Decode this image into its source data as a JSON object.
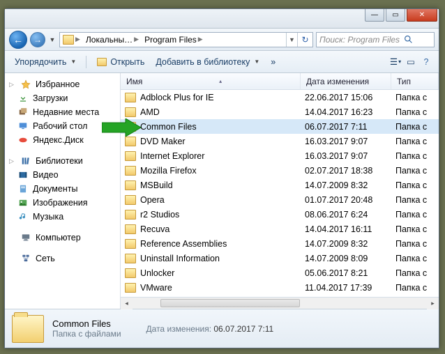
{
  "window": {
    "min_glyph": "—",
    "max_glyph": "▭",
    "close_glyph": "✕"
  },
  "nav": {
    "back_glyph": "←",
    "fwd_glyph": "→",
    "menu_glyph": "▼",
    "breadcrumbs": [
      {
        "label": "Локальны…"
      },
      {
        "label": "Program Files"
      }
    ],
    "addr_dd": "▼",
    "refresh_glyph": "↻"
  },
  "search": {
    "placeholder": "Поиск: Program Files"
  },
  "toolbar": {
    "organize": "Упорядочить",
    "open": "Открыть",
    "add_to_library": "Добавить в библиотеку",
    "share": "»",
    "view_glyph": "☰",
    "preview_glyph": "▭",
    "help_glyph": "?"
  },
  "sidebar": {
    "favorites": {
      "label": "Избранное",
      "items": [
        {
          "icon": "dl",
          "label": "Загрузки"
        },
        {
          "icon": "folder",
          "label": "Недавние места"
        },
        {
          "icon": "desk",
          "label": "Рабочий стол"
        },
        {
          "icon": "yd",
          "label": "Яндекс.Диск"
        }
      ]
    },
    "libraries": {
      "label": "Библиотеки",
      "items": [
        {
          "icon": "vid",
          "label": "Видео"
        },
        {
          "icon": "doc",
          "label": "Документы"
        },
        {
          "icon": "img",
          "label": "Изображения"
        },
        {
          "icon": "music",
          "label": "Музыка"
        }
      ]
    },
    "computer": {
      "label": "Компьютер"
    },
    "network": {
      "label": "Сеть"
    }
  },
  "columns": {
    "name": "Имя",
    "date": "Дата изменения",
    "type": "Тип",
    "sort_glyph": "▴"
  },
  "files": [
    {
      "name": "Adblock Plus for IE",
      "date": "22.06.2017 15:06",
      "type": "Папка с",
      "sel": false
    },
    {
      "name": "AMD",
      "date": "14.04.2017 16:23",
      "type": "Папка с",
      "sel": false
    },
    {
      "name": "Common Files",
      "date": "06.07.2017 7:11",
      "type": "Папка с",
      "sel": true
    },
    {
      "name": "DVD Maker",
      "date": "16.03.2017 9:07",
      "type": "Папка с",
      "sel": false
    },
    {
      "name": "Internet Explorer",
      "date": "16.03.2017 9:07",
      "type": "Папка с",
      "sel": false
    },
    {
      "name": "Mozilla Firefox",
      "date": "02.07.2017 18:38",
      "type": "Папка с",
      "sel": false
    },
    {
      "name": "MSBuild",
      "date": "14.07.2009 8:32",
      "type": "Папка с",
      "sel": false
    },
    {
      "name": "Opera",
      "date": "01.07.2017 20:48",
      "type": "Папка с",
      "sel": false
    },
    {
      "name": "r2 Studios",
      "date": "08.06.2017 6:24",
      "type": "Папка с",
      "sel": false
    },
    {
      "name": "Recuva",
      "date": "14.04.2017 16:11",
      "type": "Папка с",
      "sel": false
    },
    {
      "name": "Reference Assemblies",
      "date": "14.07.2009 8:32",
      "type": "Папка с",
      "sel": false
    },
    {
      "name": "Uninstall Information",
      "date": "14.07.2009 8:09",
      "type": "Папка с",
      "sel": false
    },
    {
      "name": "Unlocker",
      "date": "05.06.2017 8:21",
      "type": "Папка с",
      "sel": false
    },
    {
      "name": "VMware",
      "date": "11.04.2017 17:39",
      "type": "Папка с",
      "sel": false
    }
  ],
  "details": {
    "name": "Common Files",
    "subtitle": "Папка с файлами",
    "date_label": "Дата изменения:",
    "date_value": "06.07.2017 7:11"
  }
}
